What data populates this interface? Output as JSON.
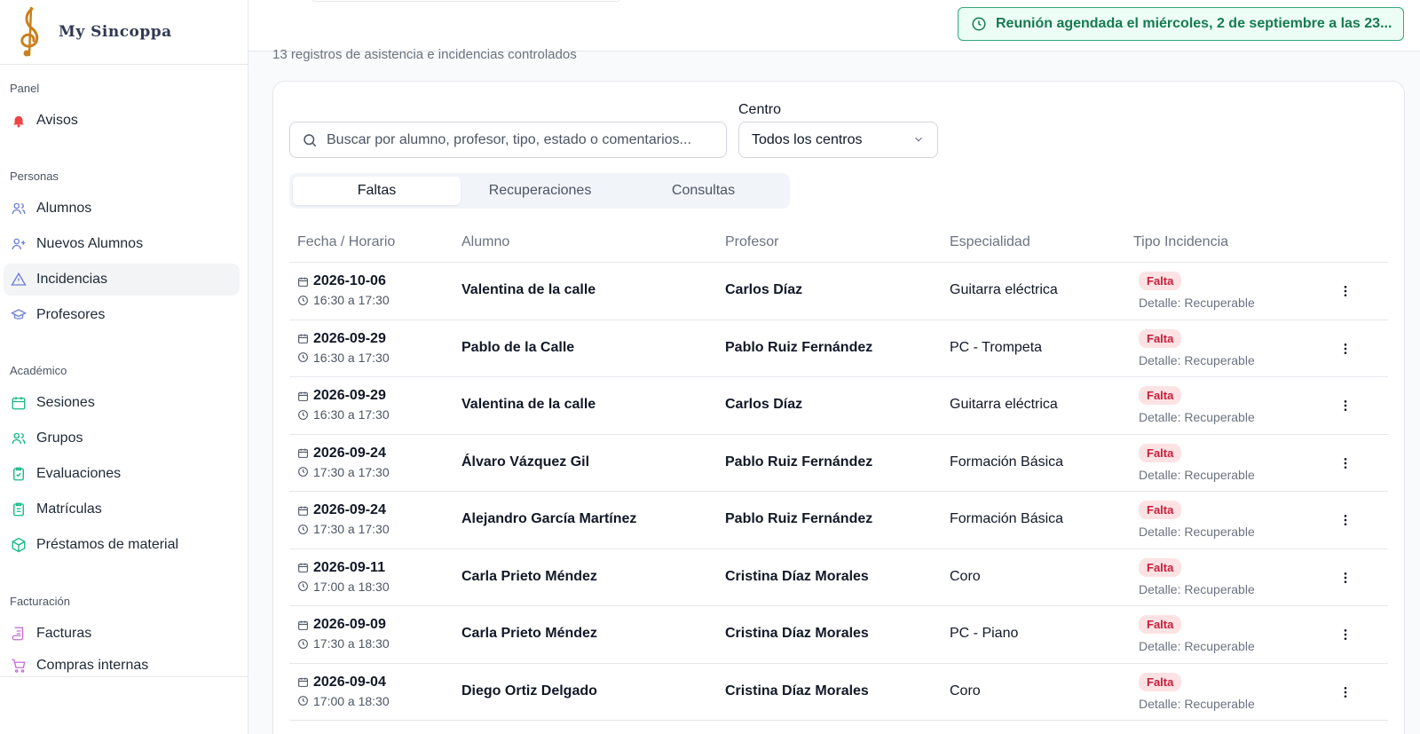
{
  "brand": {
    "name": "My Sincoppa"
  },
  "sidebar": {
    "sections": [
      {
        "title": "Panel",
        "items": [
          {
            "label": "Avisos",
            "icon": "bell-icon"
          }
        ]
      },
      {
        "title": "Personas",
        "items": [
          {
            "label": "Alumnos",
            "icon": "users-icon"
          },
          {
            "label": "Nuevos Alumnos",
            "icon": "user-plus-icon"
          },
          {
            "label": "Incidencias",
            "icon": "warning-icon",
            "active": true
          },
          {
            "label": "Profesores",
            "icon": "graduation-cap-icon"
          }
        ]
      },
      {
        "title": "Académico",
        "items": [
          {
            "label": "Sesiones",
            "icon": "calendar-icon"
          },
          {
            "label": "Grupos",
            "icon": "group-icon"
          },
          {
            "label": "Evaluaciones",
            "icon": "clipboard-check-icon"
          },
          {
            "label": "Matrículas",
            "icon": "clipboard-list-icon"
          },
          {
            "label": "Préstamos de material",
            "icon": "box-icon"
          }
        ]
      },
      {
        "title": "Facturación",
        "items": [
          {
            "label": "Facturas",
            "icon": "scroll-icon"
          },
          {
            "label": "Compras internas",
            "icon": "cart-icon"
          }
        ]
      }
    ]
  },
  "notice": {
    "text": "Reunión agendada el miércoles, 2 de septiembre a las 23...",
    "icon": "clock-icon"
  },
  "page": {
    "subtitle": "13 registros de asistencia e incidencias controlados"
  },
  "filters": {
    "search_placeholder": "Buscar por alumno, profesor, tipo, estado o comentarios...",
    "centro_label": "Centro",
    "centro_value": "Todos los centros"
  },
  "tabs": [
    {
      "label": "Faltas",
      "active": true
    },
    {
      "label": "Recuperaciones"
    },
    {
      "label": "Consultas"
    }
  ],
  "table": {
    "headers": [
      "Fecha / Horario",
      "Alumno",
      "Profesor",
      "Especialidad",
      "Tipo Incidencia"
    ],
    "rows": [
      {
        "date": "2026-10-06",
        "time": "16:30 a 17:30",
        "alumno": "Valentina de la calle",
        "profesor": "Carlos Díaz",
        "especialidad": "Guitarra eléctrica",
        "tipo": "Falta",
        "detalle": "Detalle: Recuperable"
      },
      {
        "date": "2026-09-29",
        "time": "16:30 a 17:30",
        "alumno": "Pablo de la Calle",
        "profesor": "Pablo Ruiz Fernández",
        "especialidad": "PC - Trompeta",
        "tipo": "Falta",
        "detalle": "Detalle: Recuperable"
      },
      {
        "date": "2026-09-29",
        "time": "16:30 a 17:30",
        "alumno": "Valentina de la calle",
        "profesor": "Carlos Díaz",
        "especialidad": "Guitarra eléctrica",
        "tipo": "Falta",
        "detalle": "Detalle: Recuperable"
      },
      {
        "date": "2026-09-24",
        "time": "17:30 a 17:30",
        "alumno": "Álvaro Vázquez Gil",
        "profesor": "Pablo Ruiz Fernández",
        "especialidad": "Formación Básica",
        "tipo": "Falta",
        "detalle": "Detalle: Recuperable"
      },
      {
        "date": "2026-09-24",
        "time": "17:30 a 17:30",
        "alumno": "Alejandro García Martínez",
        "profesor": "Pablo Ruiz Fernández",
        "especialidad": "Formación Básica",
        "tipo": "Falta",
        "detalle": "Detalle: Recuperable"
      },
      {
        "date": "2026-09-11",
        "time": "17:00 a 18:30",
        "alumno": "Carla Prieto Méndez",
        "profesor": "Cristina Díaz Morales",
        "especialidad": "Coro",
        "tipo": "Falta",
        "detalle": "Detalle: Recuperable"
      },
      {
        "date": "2026-09-09",
        "time": "17:30 a 18:30",
        "alumno": "Carla Prieto Méndez",
        "profesor": "Cristina Díaz Morales",
        "especialidad": "PC - Piano",
        "tipo": "Falta",
        "detalle": "Detalle: Recuperable"
      },
      {
        "date": "2026-09-04",
        "time": "17:00 a 18:30",
        "alumno": "Diego Ortiz Delgado",
        "profesor": "Cristina Díaz Morales",
        "especialidad": "Coro",
        "tipo": "Falta",
        "detalle": "Detalle: Recuperable"
      }
    ]
  },
  "colors": {
    "accent_green": "#177a52",
    "badge_red": "#c81e3a",
    "badge_bg": "#fde2e4"
  }
}
